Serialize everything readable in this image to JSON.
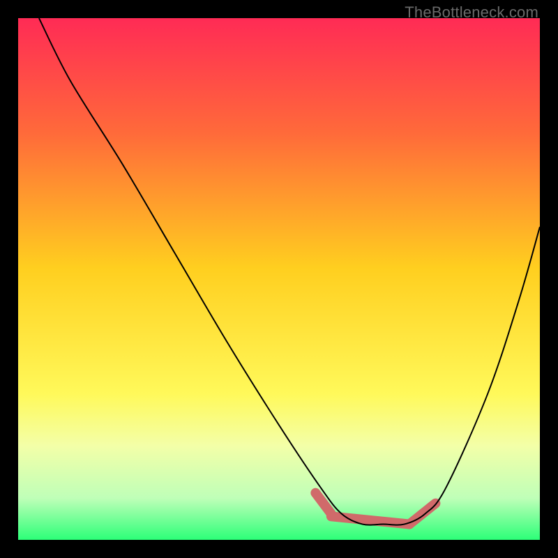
{
  "watermark": "TheBottleneck.com",
  "chart_data": {
    "type": "line",
    "title": "",
    "xlabel": "",
    "ylabel": "",
    "xlim": [
      0,
      100
    ],
    "ylim": [
      0,
      100
    ],
    "grid": false,
    "legend": false,
    "background_gradient": {
      "stops": [
        {
          "offset": 0,
          "color": "#ff2b55"
        },
        {
          "offset": 22,
          "color": "#ff6a3a"
        },
        {
          "offset": 48,
          "color": "#ffcf1f"
        },
        {
          "offset": 72,
          "color": "#fff95a"
        },
        {
          "offset": 82,
          "color": "#f3ffa8"
        },
        {
          "offset": 92,
          "color": "#bfffb8"
        },
        {
          "offset": 100,
          "color": "#2cff78"
        }
      ]
    },
    "series": [
      {
        "name": "bottleneck-curve",
        "color": "#000000",
        "x": [
          4,
          10,
          20,
          30,
          40,
          50,
          58,
          62,
          66,
          70,
          74,
          78,
          82,
          90,
          96,
          100
        ],
        "y": [
          100,
          88,
          72,
          55,
          38,
          22,
          10,
          5,
          3,
          3,
          3,
          5,
          10,
          28,
          46,
          60
        ]
      }
    ],
    "highlight": {
      "color": "#d06a6a",
      "segments": [
        {
          "x1": 57,
          "y1": 9,
          "x2": 60,
          "y2": 5
        },
        {
          "x1": 60,
          "y1": 4.5,
          "x2": 75,
          "y2": 3
        },
        {
          "x1": 75,
          "y1": 3,
          "x2": 80,
          "y2": 7
        }
      ]
    }
  }
}
